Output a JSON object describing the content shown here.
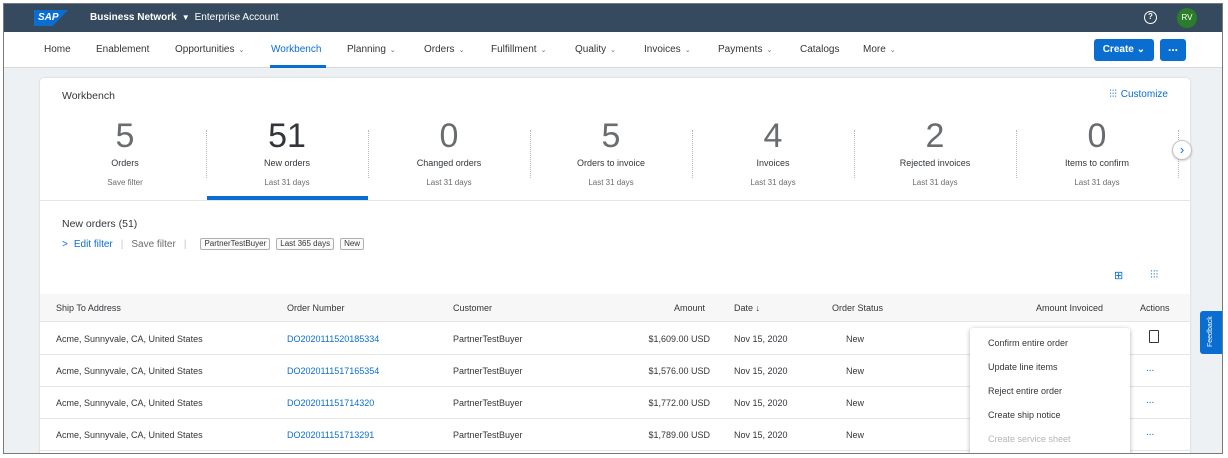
{
  "shell": {
    "logo": "SAP",
    "product": "Business Network",
    "account": "Enterprise Account",
    "help": "?",
    "avatar": "RV"
  },
  "nav": {
    "items": [
      {
        "label": "Home",
        "caret": ""
      },
      {
        "label": "Enablement",
        "caret": ""
      },
      {
        "label": "Opportunities",
        "caret": "⌄"
      },
      {
        "label": "Workbench",
        "caret": ""
      },
      {
        "label": "Planning",
        "caret": "⌄"
      },
      {
        "label": "Orders",
        "caret": "⌄"
      },
      {
        "label": "Fulfillment",
        "caret": "⌄"
      },
      {
        "label": "Quality",
        "caret": "⌄"
      },
      {
        "label": "Invoices",
        "caret": "⌄"
      },
      {
        "label": "Payments",
        "caret": "⌄"
      },
      {
        "label": "Catalogs",
        "caret": ""
      },
      {
        "label": "More",
        "caret": "⌄"
      }
    ],
    "create_label": "Create ⌄",
    "more_label": "..."
  },
  "workbench": {
    "title": "Workbench",
    "customize_label": "Customize",
    "tiles": [
      {
        "count": "5",
        "label": "Orders",
        "sub": "Save filter"
      },
      {
        "count": "51",
        "label": "New orders",
        "sub": "Last 31 days"
      },
      {
        "count": "0",
        "label": "Changed orders",
        "sub": "Last 31 days"
      },
      {
        "count": "5",
        "label": "Orders to invoice",
        "sub": "Last 31 days"
      },
      {
        "count": "4",
        "label": "Invoices",
        "sub": "Last 31 days"
      },
      {
        "count": "2",
        "label": "Rejected invoices",
        "sub": "Last 31 days"
      },
      {
        "count": "0",
        "label": "Items to confirm",
        "sub": "Last 31 days"
      }
    ]
  },
  "section": {
    "title": "New orders (51)",
    "edit_filter": "Edit filter",
    "save_filter": "Save filter",
    "chips": [
      "PartnerTestBuyer",
      "Last 365 days",
      "New"
    ]
  },
  "table": {
    "headers": {
      "ship_to": "Ship To Address",
      "order_number": "Order Number",
      "customer": "Customer",
      "amount": "Amount",
      "date": "Date",
      "date_sort": "↓",
      "status": "Order Status",
      "invoiced": "Amount Invoiced",
      "actions": "Actions"
    },
    "rows": [
      {
        "ship_to": "Acme, Sunnyvale, CA, United States",
        "order_number": "DO2020111520185334",
        "customer": "PartnerTestBuyer",
        "amount": "$1,609.00 USD",
        "date": "Nov 15, 2020",
        "status": "New"
      },
      {
        "ship_to": "Acme, Sunnyvale, CA, United States",
        "order_number": "DO2020111517165354",
        "customer": "PartnerTestBuyer",
        "amount": "$1,576.00 USD",
        "date": "Nov 15, 2020",
        "status": "New"
      },
      {
        "ship_to": "Acme, Sunnyvale, CA, United States",
        "order_number": "DO202011151714320",
        "customer": "PartnerTestBuyer",
        "amount": "$1,772.00 USD",
        "date": "Nov 15, 2020",
        "status": "New"
      },
      {
        "ship_to": "Acme, Sunnyvale, CA, United States",
        "order_number": "DO202011151713291",
        "customer": "PartnerTestBuyer",
        "amount": "$1,789.00 USD",
        "date": "Nov 15, 2020",
        "status": "New"
      }
    ],
    "row_action": "..."
  },
  "actions_menu": {
    "items": [
      {
        "label": "Confirm entire order",
        "disabled": false
      },
      {
        "label": "Update line items",
        "disabled": false
      },
      {
        "label": "Reject entire order",
        "disabled": false
      },
      {
        "label": "Create ship notice",
        "disabled": false
      },
      {
        "label": "Create service sheet",
        "disabled": true
      }
    ]
  },
  "feedback_label": "Feedback",
  "colors": {
    "shell": "#354a5f",
    "accent": "#0a6ed1",
    "avatar": "#2b7d2b"
  },
  "icons": [
    "help-icon",
    "customize-icon",
    "chevron-right-icon",
    "table-settings-icon",
    "filter-settings-icon",
    "document-icon"
  ]
}
